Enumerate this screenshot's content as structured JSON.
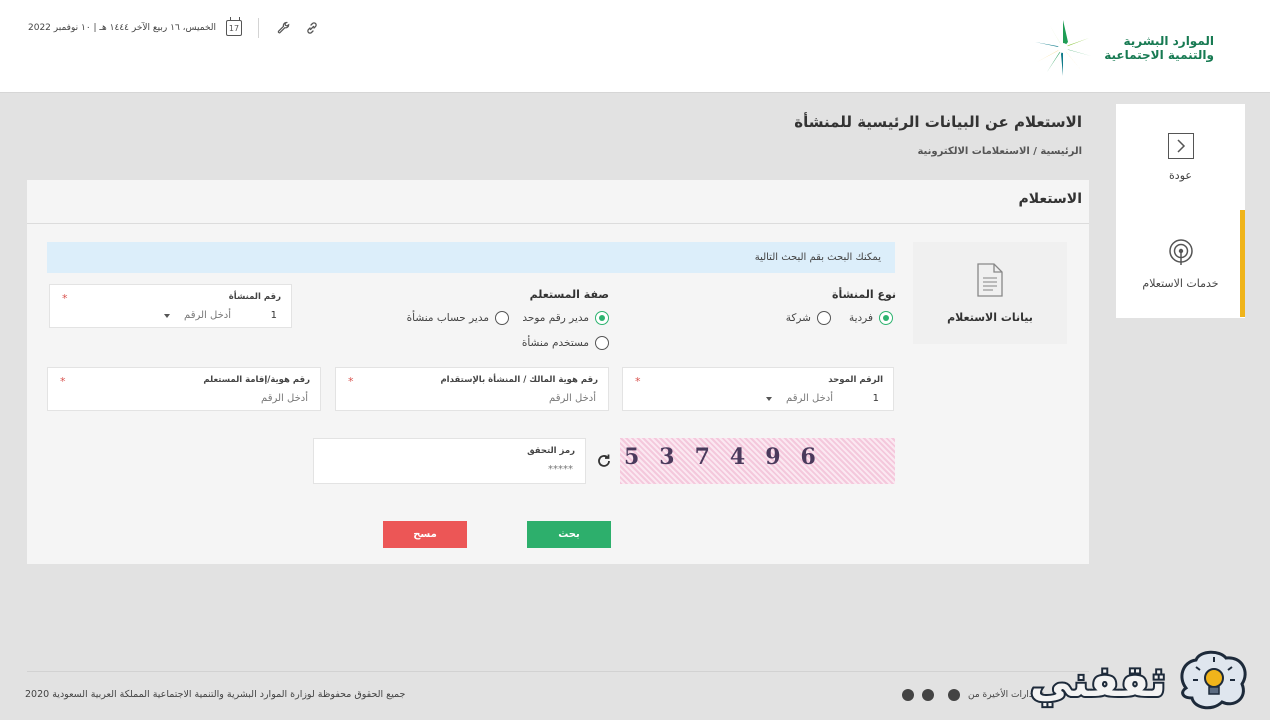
{
  "header": {
    "logo_line1": "الموارد البشرية",
    "logo_line2": "والتنمية الاجتماعية",
    "date_text": "الخميس، ١٦ ربيع الآخر ١٤٤٤ هـ | ١٠ نوفمبر 2022",
    "calendar_day": "17"
  },
  "sidebar": {
    "back_label": "عودة",
    "services_label": "خدمات الاستعلام"
  },
  "page": {
    "title": "الاستعلام عن البيانات الرئيسية للمنشأة",
    "breadcrumb": "الرئيسية / الاستعلامات الالكترونية"
  },
  "card": {
    "title": "الاستعلام",
    "data_tile_label": "بيانات الاستعلام",
    "info_message": "يمكنك البحث بقم البحث التالية"
  },
  "form": {
    "establishment_type": {
      "title": "نوع المنشأة",
      "options": [
        "فردية",
        "شركة"
      ],
      "selected": "فردية"
    },
    "inquirer_role": {
      "title": "صفة المستعلم",
      "options": [
        "مدير رقم موحد",
        "مدير حساب منشأة",
        "مستخدم منشأة"
      ],
      "selected": "مدير رقم موحد"
    },
    "establishment_number": {
      "label": "رقم المنشأة",
      "prefix_value": "1",
      "placeholder": "أدخل الرقم"
    },
    "unified_number": {
      "label": "الرقم الموحد",
      "prefix_value": "1",
      "placeholder": "أدخل الرقم"
    },
    "owner_id": {
      "label": "رقم هوية المالك / المنشأة بالإستقدام",
      "placeholder": "أدخل الرقم"
    },
    "inquirer_id": {
      "label": "رقم هوية/إقامة المستعلم",
      "placeholder": "أدخل الرقم"
    },
    "captcha": {
      "label": "رمز التحقق",
      "value": "*****",
      "image_text": "537496"
    },
    "search_label": "بحث",
    "clear_label": "مسح",
    "required_mark": "*"
  },
  "footer": {
    "copyright": "جميع الحقوق محفوظة لوزارة الموارد البشرية والتنمية الاجتماعية المملكة العربية السعودية 2020",
    "browsers_label": "صدارات الأخيرة من:",
    "watermark_text": "ثقفني"
  },
  "colors": {
    "primary_green": "#2daf6c",
    "danger_red": "#ec5656",
    "accent_yellow": "#f0b41b",
    "info_blue": "#dceefa"
  }
}
